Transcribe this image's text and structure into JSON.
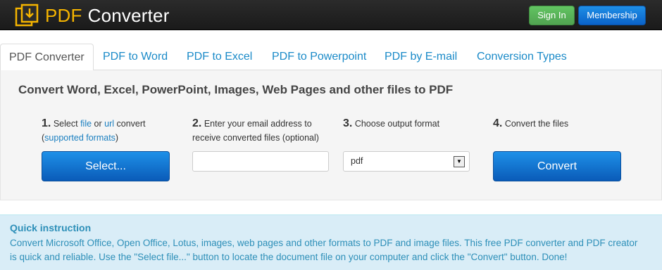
{
  "header": {
    "brand_pdf": "PDF",
    "brand_converter": "Converter",
    "signin_label": "Sign In",
    "membership_label": "Membership"
  },
  "tabs": [
    {
      "label": "PDF Converter"
    },
    {
      "label": "PDF to Word"
    },
    {
      "label": "PDF to Excel"
    },
    {
      "label": "PDF to Powerpoint"
    },
    {
      "label": "PDF by E-mail"
    },
    {
      "label": "Conversion Types"
    }
  ],
  "main": {
    "heading": "Convert Word, Excel, PowerPoint, Images, Web Pages and other files to PDF",
    "step1": {
      "num": "1.",
      "text_select": "Select",
      "link_file": "file",
      "text_or": "or",
      "link_url": "url",
      "text_convert": "convert",
      "paren_open": "(",
      "link_formats": "supported formats",
      "paren_close": ")",
      "button": "Select..."
    },
    "step2": {
      "num": "2.",
      "line1": "Enter your email address to",
      "line2": "receive converted files (optional)",
      "email_value": "",
      "email_placeholder": ""
    },
    "step3": {
      "num": "3.",
      "text": "Choose output format",
      "format_selected": "pdf"
    },
    "step4": {
      "num": "4.",
      "text": "Convert the files",
      "button": "Convert"
    }
  },
  "instruction": {
    "title": "Quick instruction",
    "text": "Convert Microsoft Office, Open Office, Lotus, images, web pages and other formats to PDF and image files. This free PDF converter and PDF creator is quick and reliable. Use the \"Select file...\" button to locate the document file on your computer and click the \"Convert\" button. Done!"
  }
}
